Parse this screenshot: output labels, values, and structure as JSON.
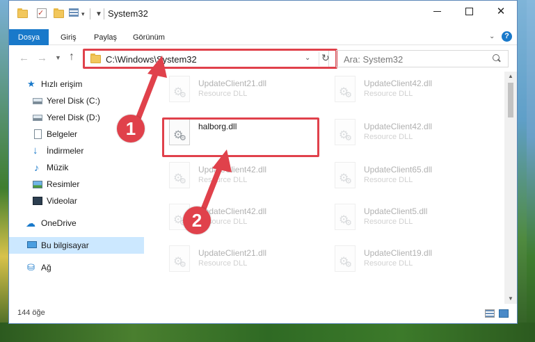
{
  "window": {
    "title": "System32",
    "controls": {
      "minimize": "minimize",
      "maximize": "maximize",
      "close": "✕"
    }
  },
  "ribbon": {
    "tabs": [
      "Dosya",
      "Giriş",
      "Paylaş",
      "Görünüm"
    ],
    "help": "?"
  },
  "address": {
    "path": "C:\\Windows\\System32",
    "search_placeholder": "Ara: System32"
  },
  "nav_pane": {
    "items": [
      {
        "label": "Hızlı erişim",
        "icon": "star-icon"
      },
      {
        "label": "Yerel Disk (C:)",
        "icon": "drive-icon",
        "pinned": true
      },
      {
        "label": "Yerel Disk (D:)",
        "icon": "drive-icon",
        "pinned": true
      },
      {
        "label": "Belgeler",
        "icon": "document-icon",
        "pinned": true
      },
      {
        "label": "İndirmeler",
        "icon": "download-icon",
        "pinned": true
      },
      {
        "label": "Müzik",
        "icon": "music-icon",
        "pinned": true
      },
      {
        "label": "Resimler",
        "icon": "pictures-icon",
        "pinned": true
      },
      {
        "label": "Videolar",
        "icon": "video-icon",
        "pinned": true
      },
      {
        "label": "OneDrive",
        "icon": "cloud-icon"
      },
      {
        "label": "Bu bilgisayar",
        "icon": "computer-icon",
        "selected": true
      },
      {
        "label": "Ağ",
        "icon": "network-icon"
      }
    ]
  },
  "files": [
    {
      "name": "UpdateClient21.dll",
      "type": "Resource DLL"
    },
    {
      "name": "UpdateClient42.dll",
      "type": "Resource DLL"
    },
    {
      "name": "halborg.dll",
      "type": ""
    },
    {
      "name": "UpdateClient42.dll",
      "type": "Resource DLL"
    },
    {
      "name": "UpdateClient42.dll",
      "type": "Resource DLL"
    },
    {
      "name": "UpdateClient65.dll",
      "type": "Resource DLL"
    },
    {
      "name": "UpdateClient42.dll",
      "type": "Resource DLL"
    },
    {
      "name": "UpdateClient5.dll",
      "type": "Resource DLL"
    },
    {
      "name": "UpdateClient21.dll",
      "type": "Resource DLL"
    },
    {
      "name": "UpdateClient19.dll",
      "type": "Resource DLL"
    }
  ],
  "status": {
    "item_count": "144 öğe"
  },
  "annotations": {
    "step1": "1",
    "step2": "2",
    "color": "#e0414b"
  }
}
